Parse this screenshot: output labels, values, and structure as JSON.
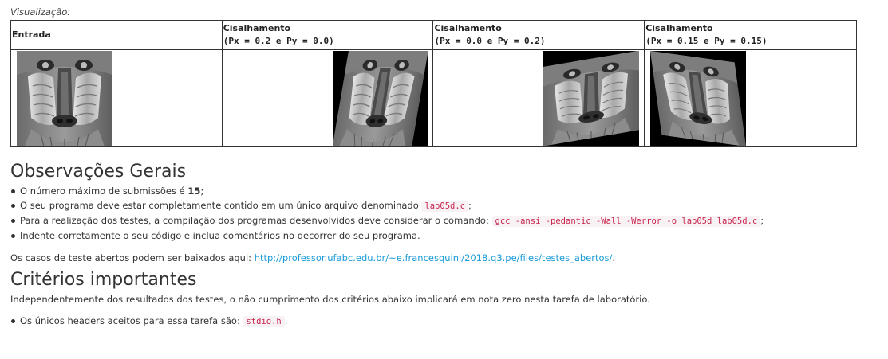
{
  "visualization": {
    "label": "Visualização:",
    "columns": [
      {
        "title": "Entrada",
        "params": ""
      },
      {
        "title": "Cisalhamento",
        "params": "(Px = 0.2 e Py = 0.0)"
      },
      {
        "title": "Cisalhamento",
        "params": "(Px = 0.0 e Py = 0.2)"
      },
      {
        "title": "Cisalhamento",
        "params": "(Px = 0.15 e Py = 0.15)"
      }
    ],
    "images": [
      "mandrill-input",
      "mandrill-shear-x",
      "mandrill-shear-y",
      "mandrill-shear-xy"
    ]
  },
  "observacoes": {
    "heading": "Observações Gerais",
    "item1_prefix": "O número máximo de submissões é ",
    "item1_bold": "15",
    "item1_suffix": ";",
    "item2_prefix": "O seu programa deve estar completamente contido em um único arquivo denominado ",
    "item2_code": "lab05d.c",
    "item2_suffix": ";",
    "item3_prefix": "Para a realização dos testes, a compilação dos programas desenvolvidos deve considerar o comando: ",
    "item3_code": "gcc -ansi -pedantic -Wall -Werror -o lab05d lab05d.c",
    "item3_suffix": ";",
    "item4": "Indente corretamente o seu código e inclua comentários no decorrer do seu programa."
  },
  "testcases": {
    "text": "Os casos de teste abertos podem ser baixados aqui: ",
    "link": "http://professor.ufabc.edu.br/~e.francesquini/2018.q3.pe/files/testes_abertos/",
    "after": "."
  },
  "criterios": {
    "heading": "Critérios importantes",
    "intro": "Independentemente dos resultados dos testes, o não cumprimento dos critérios abaixo implicará em nota zero nesta tarefa de laboratório.",
    "item1_prefix": "Os únicos headers aceitos para essa tarefa são: ",
    "item1_code": "stdio.h",
    "item1_suffix": "."
  }
}
